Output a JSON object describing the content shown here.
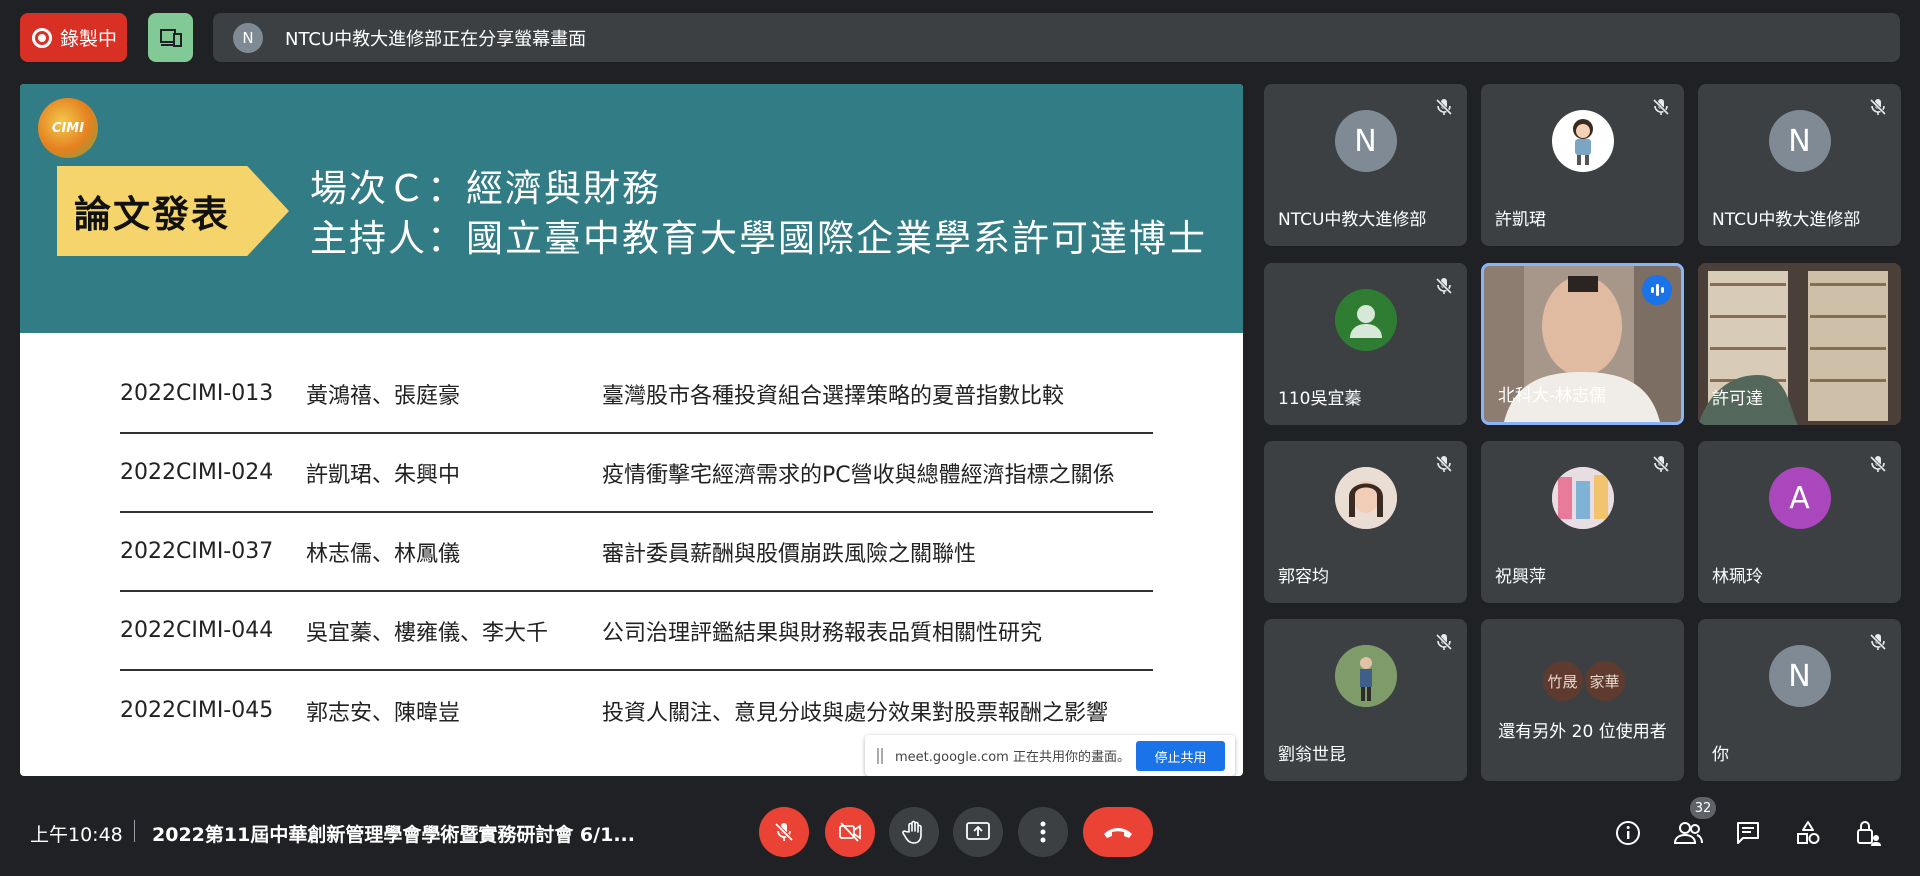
{
  "top_bar": {
    "recording_label": "錄製中",
    "share_avatar_initial": "N",
    "share_banner_text": "NTCU中教大進修部正在分享螢幕畫面"
  },
  "slide": {
    "logo_text": "CIMI",
    "session_tag": "論文發表",
    "title_line1": "場次Ｃ：經濟與財務",
    "title_line2": "主持人：國立臺中教育大學國際企業學系許可達博士",
    "papers": [
      {
        "id": "2022CIMI-013",
        "authors": "黃鴻禧、張庭豪",
        "title": "臺灣股市各種投資組合選擇策略的夏普指數比較"
      },
      {
        "id": "2022CIMI-024",
        "authors": "許凱珺、朱興中",
        "title": "疫情衝擊宅經濟需求的PC營收與總體經濟指標之關係"
      },
      {
        "id": "2022CIMI-037",
        "authors": "林志儒、林鳳儀",
        "title": "審計委員薪酬與股價崩跌風險之關聯性"
      },
      {
        "id": "2022CIMI-044",
        "authors": "吳宜蓁、樓雍儀、李大千",
        "title": "公司治理評鑑結果與財務報表品質相關性研究"
      },
      {
        "id": "2022CIMI-045",
        "authors": "郭志安、陳暐豈",
        "title": "投資人關注、意見分歧與處分效果對股票報酬之影響"
      }
    ]
  },
  "share_pill": {
    "text": "meet.google.com 正在共用你的畫面。",
    "stop_label": "停止共用"
  },
  "participants": [
    {
      "name": "NTCU中教大進修部",
      "initial": "N",
      "color": "#7f8a94"
    },
    {
      "name": "許凱珺",
      "initial": "",
      "color": "#ffffff"
    },
    {
      "name": "NTCU中教大進修部",
      "initial": "N",
      "color": "#7f8a94"
    },
    {
      "name": "110吳宜蓁",
      "initial": "",
      "color": "#2e7d32"
    },
    {
      "name": "北科大-林志儒",
      "initial": "",
      "color": "#c9b8a6"
    },
    {
      "name": "許可達",
      "initial": "",
      "color": "#8a7b66"
    },
    {
      "name": "郭容均",
      "initial": "",
      "color": "#c7a08a"
    },
    {
      "name": "祝興萍",
      "initial": "",
      "color": "#d6c3c8"
    },
    {
      "name": "林珮玲",
      "initial": "A",
      "color": "#ab47bc"
    },
    {
      "name": "劉翁世昆",
      "initial": "",
      "color": "#6b8e5a"
    },
    {
      "name": "你",
      "initial": "N",
      "color": "#7f8a94"
    }
  ],
  "more_tile": {
    "avatar1": "竹晟",
    "avatar2": "家華",
    "label": "還有另外 20 位使用者"
  },
  "bottom_bar": {
    "time": "上午10:48",
    "meeting_title": "2022第11屆中華創新管理學會學術暨實務研討會 6/1...",
    "people_count": "32"
  }
}
